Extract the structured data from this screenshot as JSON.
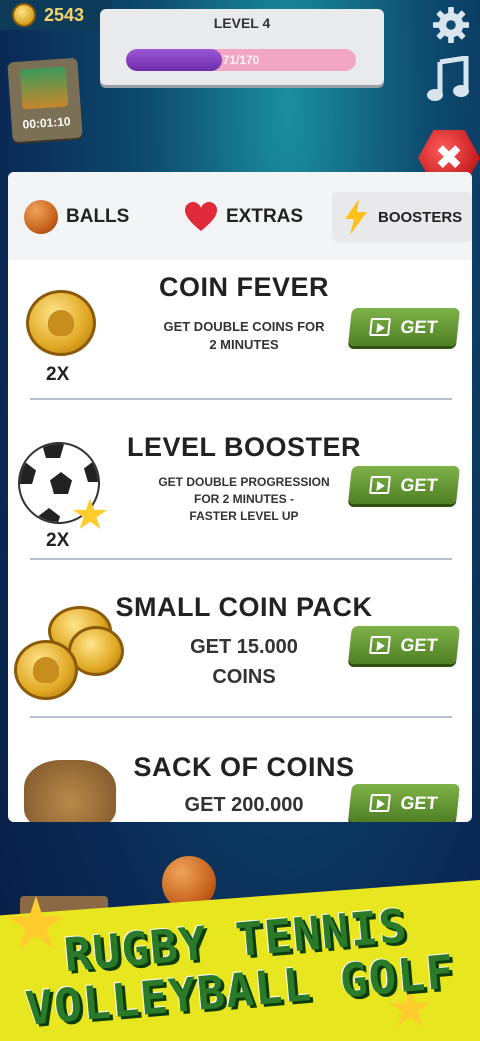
{
  "hud": {
    "coins": "2543",
    "level_title": "LEVEL 4",
    "progress_text": "71/170",
    "progress_fraction": 0.4176,
    "timer": "00:01:10"
  },
  "tabs": [
    {
      "label": "BALLS",
      "icon": "basketball-icon"
    },
    {
      "label": "EXTRAS",
      "icon": "heart-icon"
    },
    {
      "label": "BOOSTERS",
      "icon": "lightning-bolt-icon",
      "active": true
    }
  ],
  "items": [
    {
      "title": "COIN FEVER",
      "desc_lines": [
        "GET DOUBLE COINS FOR",
        "2 MINUTES"
      ],
      "multiplier": "2X",
      "button": "GET"
    },
    {
      "title": "LEVEL BOOSTER",
      "desc_lines": [
        "GET DOUBLE PROGRESSION",
        "FOR 2 MINUTES -",
        "FASTER LEVEL UP"
      ],
      "multiplier": "2X",
      "button": "GET"
    },
    {
      "title": "SMALL COIN PACK",
      "desc_lines": [
        "GET 15.000",
        "COINS"
      ],
      "button": "GET"
    },
    {
      "title": "SACK OF COINS",
      "desc_lines": [
        "GET 200.000"
      ],
      "button": "GET"
    }
  ],
  "banner": {
    "line1": "RUGBY TENNIS",
    "line2": "VOLLEYBALL GOLF ..."
  },
  "colors": {
    "get_button": "#5f9530",
    "progress_fill": "#7a3bb8",
    "close_button": "#d42222",
    "banner_bg": "#e8e61e"
  }
}
